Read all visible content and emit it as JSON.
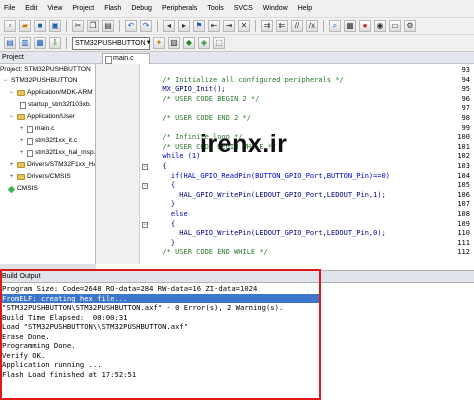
{
  "menu": [
    "File",
    "Edit",
    "View",
    "Project",
    "Flash",
    "Debug",
    "Peripherals",
    "Tools",
    "SVCS",
    "Window",
    "Help"
  ],
  "toolbar": {
    "target_name": "STM32PUSHBUTTON"
  },
  "project": {
    "header": "Project",
    "tree": [
      {
        "label": "Project: STM32PUSHBUTTON",
        "icon": "project-icon"
      },
      {
        "label": "STM32PUSHBUTTON",
        "icon": "target-icon"
      },
      {
        "label": "Application/MDK-ARM",
        "icon": "folder-icon"
      },
      {
        "label": "startup_stm32f103xb.",
        "icon": "file-icon"
      },
      {
        "label": "Application/User",
        "icon": "folder-icon"
      },
      {
        "label": "main.c",
        "icon": "file-icon"
      },
      {
        "label": "stm32f1xx_it.c",
        "icon": "file-icon"
      },
      {
        "label": "stm32f1xx_hal_msp.c",
        "icon": "file-icon"
      },
      {
        "label": "Drivers/STM32F1xx_HAL_",
        "icon": "folder-icon"
      },
      {
        "label": "Drivers/CMSIS",
        "icon": "folder-icon"
      },
      {
        "label": "CMSIS",
        "icon": "gem-icon"
      }
    ]
  },
  "editor": {
    "tab": "main.c",
    "lines": [
      {
        "n": "93",
        "text": ""
      },
      {
        "n": "94",
        "text": "  /* Initialize all configured peripherals */"
      },
      {
        "n": "95",
        "text": "  MX_GPIO_Init();"
      },
      {
        "n": "96",
        "text": "  /* USER CODE BEGIN 2 */"
      },
      {
        "n": "97",
        "text": ""
      },
      {
        "n": "98",
        "text": "  /* USER CODE END 2 */"
      },
      {
        "n": "99",
        "text": ""
      },
      {
        "n": "100",
        "text": "  /* Infinite loop */"
      },
      {
        "n": "101",
        "text": "  /* USER CODE BEGIN WHILE */"
      },
      {
        "n": "102",
        "text": "  while (1)"
      },
      {
        "n": "103",
        "text": "  {"
      },
      {
        "n": "104",
        "text": "    if(HAL_GPIO_ReadPin(BUTTON_GPIO_Port,BUTTON_Pin)==0)"
      },
      {
        "n": "105",
        "text": "    {"
      },
      {
        "n": "106",
        "text": "      HAL_GPIO_WritePin(LEDOUT_GPIO_Port,LEDOUT_Pin,1);"
      },
      {
        "n": "107",
        "text": "    }"
      },
      {
        "n": "108",
        "text": "    else"
      },
      {
        "n": "109",
        "text": "    {"
      },
      {
        "n": "110",
        "text": "      HAL_GPIO_WritePin(LEDOUT_GPIO_Port,LEDOUT_Pin,0);"
      },
      {
        "n": "111",
        "text": "    }"
      },
      {
        "n": "112",
        "text": "  /* USER CODE END WHILE */"
      }
    ],
    "watermark": "irenx.ir"
  },
  "build": {
    "header": "Build Output",
    "lines": [
      "Program Size: Code=2648 RO-data=284 RW-data=16 ZI-data=1024",
      "FromELF: creating hex file...",
      "\"STM32PUSHBUTTON\\STM32PUSHBUTTON.axf\" - 0 Error(s), 2 Warning(s).",
      "Build Time Elapsed:  00:00:31",
      "Load \"STM32PUSHBUTTON\\\\STM32PUSHBUTTON.axf\"",
      "Erase Done.",
      "Programming Done.",
      "Verify OK.",
      "Application running ...",
      "Flash Load finished at 17:52:51"
    ],
    "selected_line": 1
  },
  "colors": {
    "highlight_box": "#e01818",
    "selection": "#3e76c9",
    "comment": "#2a7a2a",
    "code": "#000080"
  }
}
